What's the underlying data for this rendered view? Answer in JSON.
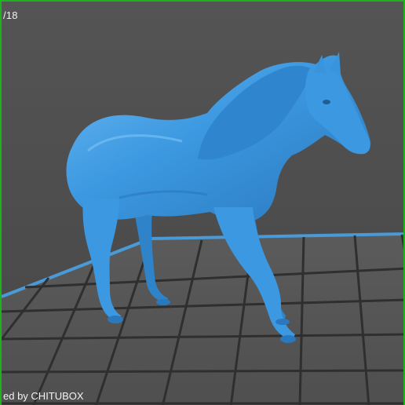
{
  "viewer": {
    "layer_counter": "/18",
    "watermark": "ed by CHITUBOX"
  },
  "model": {
    "name_icon": "horse-model",
    "color": "#3c98e0",
    "shadow_color": "#1f5e95",
    "highlight_color": "#7cc4f7"
  },
  "build_plate": {
    "grid_color": "#2d2d2d",
    "plate_color": "#5a5a5a",
    "edge_color": "#4a9ad8"
  }
}
